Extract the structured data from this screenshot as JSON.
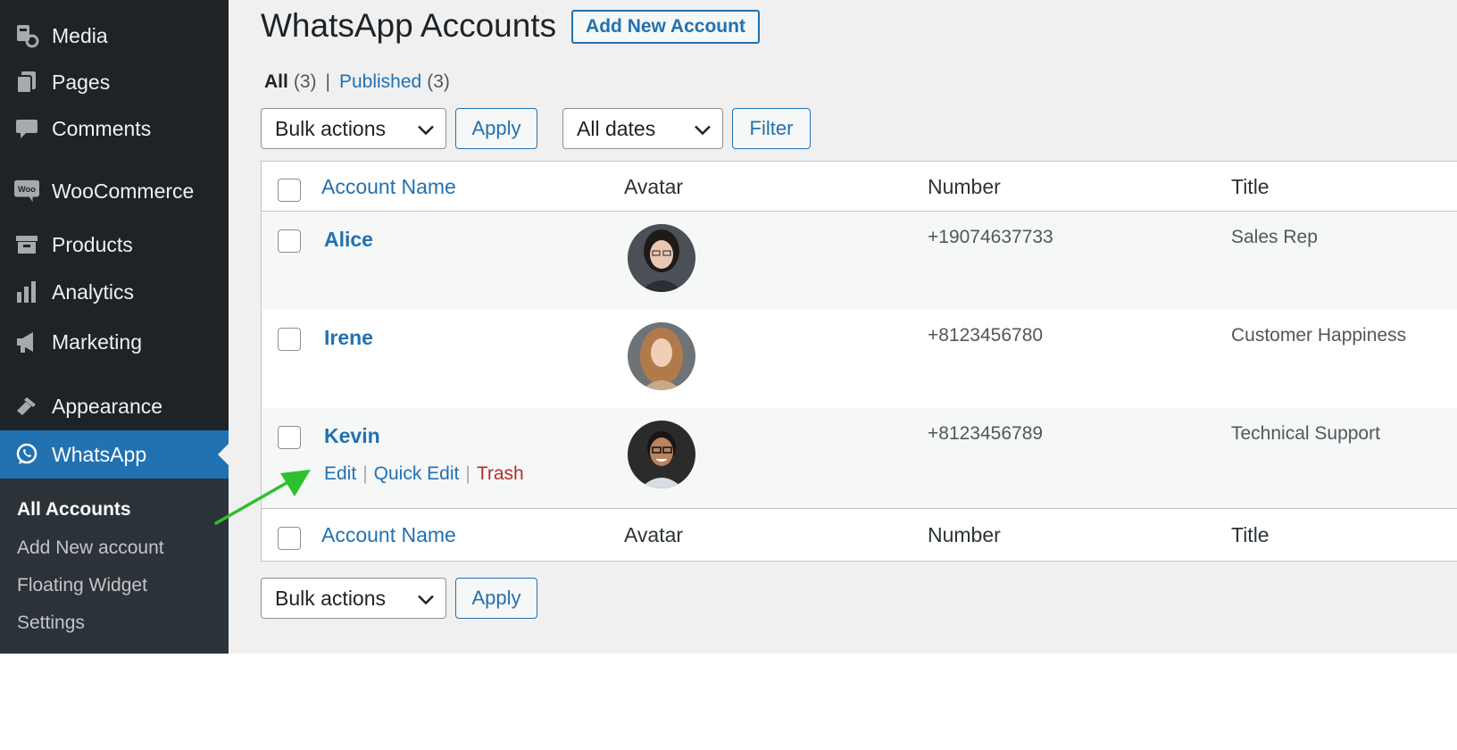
{
  "sidebar": {
    "items": [
      {
        "label": "Media",
        "icon": "media-icon"
      },
      {
        "label": "Pages",
        "icon": "pages-icon"
      },
      {
        "label": "Comments",
        "icon": "comments-icon"
      },
      {
        "label": "WooCommerce",
        "icon": "woocommerce-icon"
      },
      {
        "label": "Products",
        "icon": "products-icon"
      },
      {
        "label": "Analytics",
        "icon": "analytics-icon"
      },
      {
        "label": "Marketing",
        "icon": "megaphone-icon"
      },
      {
        "label": "Appearance",
        "icon": "paintbrush-icon"
      },
      {
        "label": "WhatsApp",
        "icon": "whatsapp-icon",
        "current": true
      }
    ],
    "woo_icon_text": "Woo",
    "submenu": [
      {
        "label": "All Accounts",
        "current": true
      },
      {
        "label": "Add New account"
      },
      {
        "label": "Floating Widget"
      },
      {
        "label": "Settings"
      }
    ]
  },
  "page": {
    "title": "WhatsApp Accounts",
    "add_new_label": "Add New Account"
  },
  "views": {
    "all_label": "All",
    "all_count": "(3)",
    "separator": "|",
    "published_label": "Published",
    "published_count": "(3)"
  },
  "toolbar": {
    "bulk_actions": "Bulk actions",
    "apply": "Apply",
    "dates": "All dates",
    "filter": "Filter"
  },
  "table": {
    "columns": {
      "name": "Account Name",
      "avatar": "Avatar",
      "number": "Number",
      "title": "Title"
    },
    "rows": [
      {
        "name": "Alice",
        "number": "+19074637733",
        "title": "Sales Rep"
      },
      {
        "name": "Irene",
        "number": "+8123456780",
        "title": "Customer Happiness"
      },
      {
        "name": "Kevin",
        "number": "+8123456789",
        "title": "Technical Support"
      }
    ],
    "row_actions": {
      "edit": "Edit",
      "quick_edit": "Quick Edit",
      "trash": "Trash",
      "sep": "|"
    }
  },
  "colors": {
    "sidebar_bg": "#1d2327",
    "accent": "#2271b1",
    "trash": "#b32d2e",
    "annotation_arrow": "#2ec02e"
  }
}
